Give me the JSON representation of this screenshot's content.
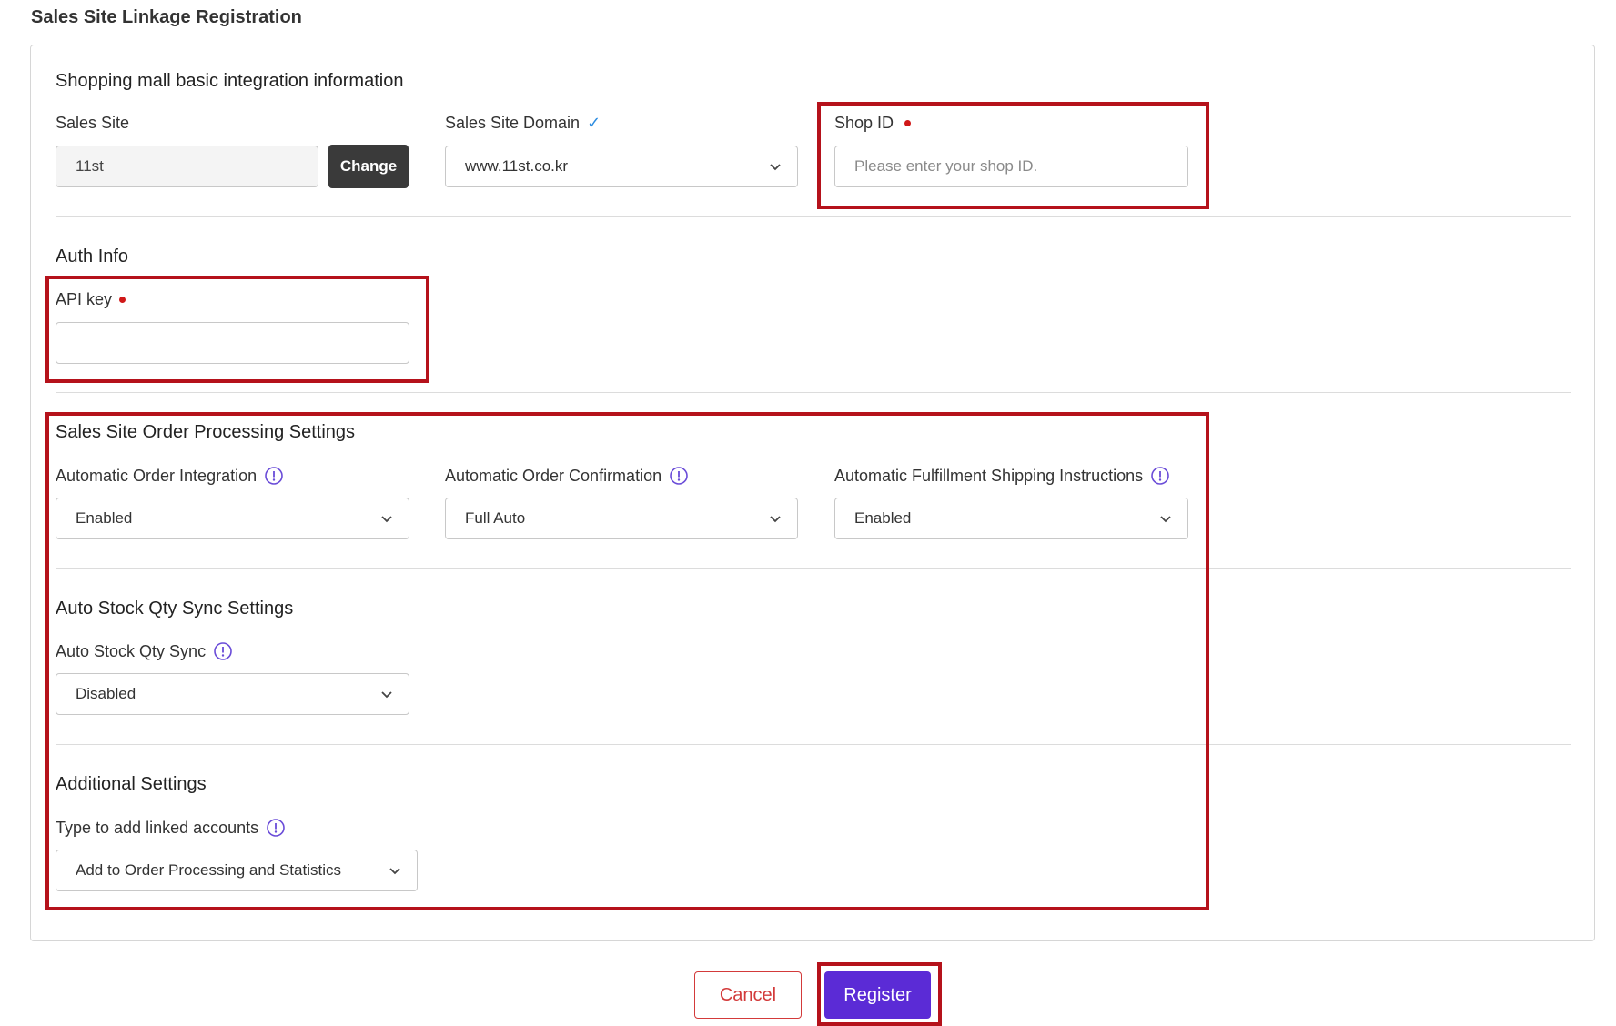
{
  "page_title": "Sales Site Linkage Registration",
  "basic": {
    "title": "Shopping mall basic integration information",
    "sales_site_label": "Sales Site",
    "sales_site_value": "11st",
    "change_button": "Change",
    "domain_label": "Sales Site Domain",
    "domain_value": "www.11st.co.kr",
    "shop_id_label": "Shop ID",
    "shop_id_placeholder": "Please enter your shop ID."
  },
  "auth": {
    "title": "Auth Info",
    "api_key_label": "API key",
    "api_key_value": ""
  },
  "order_processing": {
    "title": "Sales Site Order Processing Settings",
    "auto_order_integration_label": "Automatic Order Integration",
    "auto_order_integration_value": "Enabled",
    "auto_order_confirmation_label": "Automatic Order Confirmation",
    "auto_order_confirmation_value": "Full Auto",
    "auto_fulfillment_label": "Automatic Fulfillment Shipping Instructions",
    "auto_fulfillment_value": "Enabled"
  },
  "stock_sync": {
    "title": "Auto Stock Qty Sync Settings",
    "label": "Auto Stock Qty Sync",
    "value": "Disabled"
  },
  "additional": {
    "title": "Additional Settings",
    "linked_accounts_label": "Type to add linked accounts",
    "linked_accounts_value": "Add to Order Processing and Statistics"
  },
  "actions": {
    "cancel": "Cancel",
    "register": "Register"
  },
  "colors": {
    "highlight": "#b5121b",
    "primary": "#5b2bd6",
    "required": "#d01818",
    "info_icon": "#6a4cd8"
  }
}
